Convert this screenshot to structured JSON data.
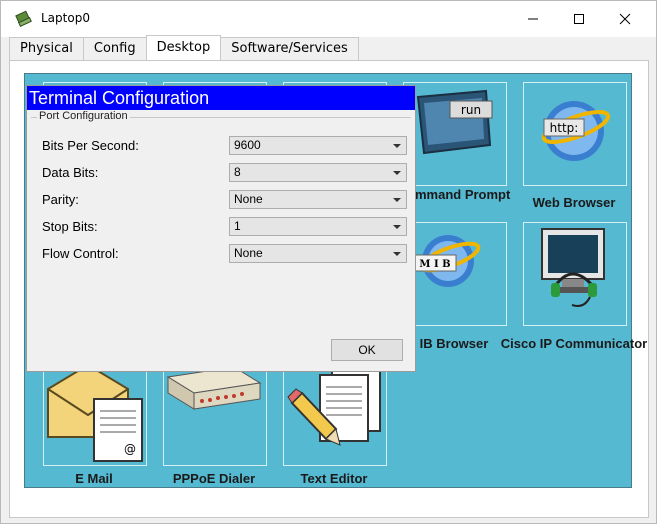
{
  "window": {
    "title": "Laptop0"
  },
  "tabs": [
    {
      "label": "Physical"
    },
    {
      "label": "Config"
    },
    {
      "label": "Desktop"
    },
    {
      "label": "Software/Services"
    }
  ],
  "desktop": {
    "apps": {
      "command_prompt": {
        "label": "Command Prompt",
        "icon_text": "run"
      },
      "web_browser": {
        "label": "Web Browser",
        "icon_text": "http:"
      },
      "mib_browser": {
        "label": "IB Browser",
        "icon_text": "M I B"
      },
      "cisco_ip": {
        "label": "Cisco IP Communicator"
      },
      "email": {
        "label": "E Mail"
      },
      "pppoe": {
        "label": "PPPoE Dialer"
      },
      "text_editor": {
        "label": "Text Editor"
      }
    }
  },
  "dialog": {
    "title": "Terminal Configuration",
    "group_label": "Port Configuration",
    "fields": [
      {
        "label": "Bits Per Second:",
        "value": "9600"
      },
      {
        "label": "Data Bits:",
        "value": "8"
      },
      {
        "label": "Parity:",
        "value": "None"
      },
      {
        "label": "Stop Bits:",
        "value": "1"
      },
      {
        "label": "Flow Control:",
        "value": "None"
      }
    ],
    "ok_label": "OK"
  },
  "colors": {
    "desktop_bg": "#56b9d2",
    "dialog_title_bg": "#0000ff"
  }
}
